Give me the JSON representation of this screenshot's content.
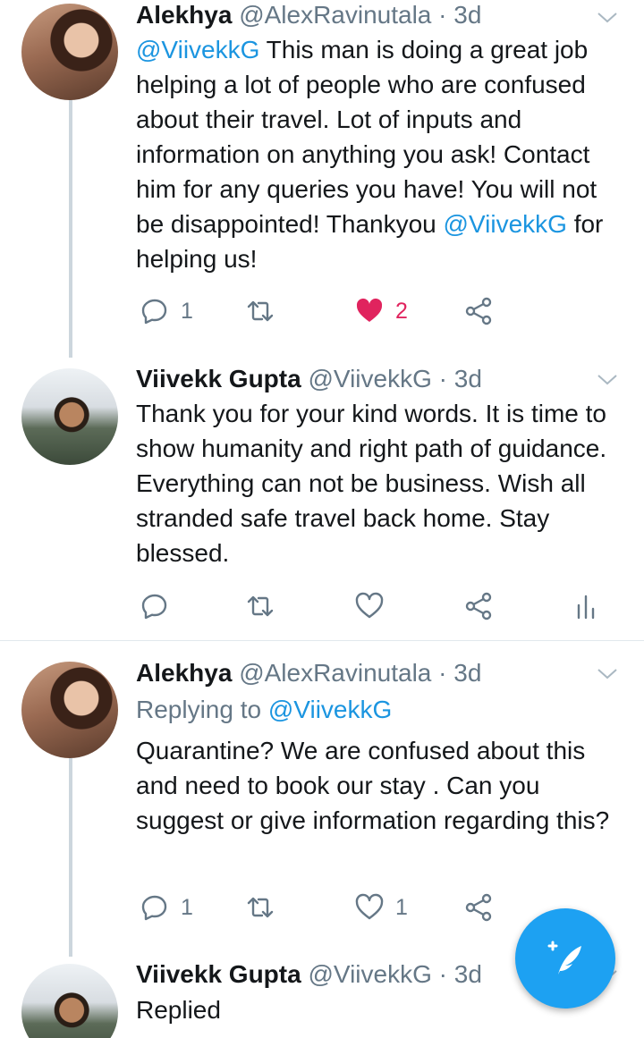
{
  "tweets": [
    {
      "name": "Alekhya",
      "handle": "@AlexRavinutala",
      "time": "· 3d",
      "body": [
        {
          "text": "@ViivekkG",
          "type": "mention"
        },
        {
          "text": "  This man is doing a great job helping a lot of people who are confused about their travel. Lot of inputs and information on anything you ask! Contact him for any queries you have! You will not be disappointed! Thankyou ",
          "type": "text"
        },
        {
          "text": "@ViivekkG",
          "type": "mention"
        },
        {
          "text": " for helping us!",
          "type": "text"
        }
      ],
      "reply_count": "1",
      "like_count": "2",
      "liked": true
    },
    {
      "name": "Viivekk Gupta",
      "handle": "@ViivekkG",
      "time": "· 3d",
      "body_text": "Thank you for your kind words. It is time to show humanity and right path of guidance. Everything can not be business. Wish all stranded safe travel back home. Stay blessed."
    },
    {
      "name": "Alekhya",
      "handle": "@AlexRavinutala",
      "time": "· 3d",
      "replying_prefix": "Replying to",
      "replying_handle": "@ViivekkG",
      "body_text": "Quarantine? We are confused about this and need to book our stay . Can you suggest or give information regarding this?",
      "reply_count": "1",
      "like_count": "1"
    },
    {
      "name": "Viivekk Gupta",
      "handle": "@ViivekkG",
      "time": "· 3d",
      "body_text": "Replied"
    }
  ],
  "icons": {
    "reply": "reply-icon",
    "retweet": "retweet-icon",
    "like": "heart-icon",
    "share": "share-icon",
    "analytics": "analytics-icon",
    "compose": "compose-tweet-icon"
  },
  "colors": {
    "accent": "#1da1f2",
    "mention": "#1b95e0",
    "liked": "#e0245e",
    "muted": "#657786"
  }
}
